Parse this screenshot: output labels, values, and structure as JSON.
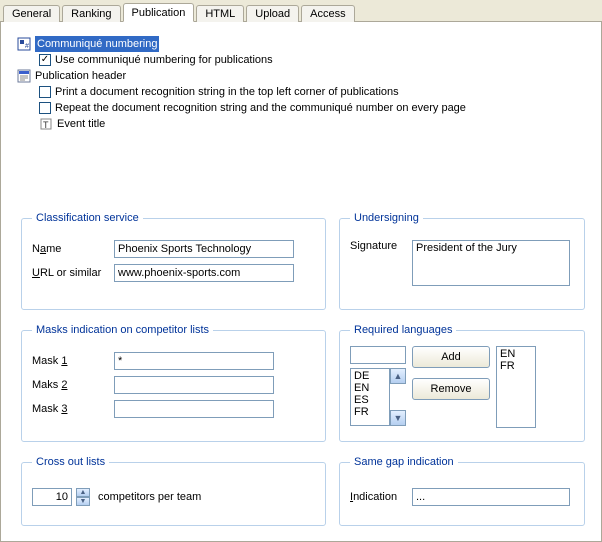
{
  "tabs": {
    "general": "General",
    "ranking": "Ranking",
    "publication": "Publication",
    "html": "HTML",
    "upload": "Upload",
    "access": "Access"
  },
  "tree": {
    "communique_numbering": "Communiqué numbering",
    "use_communique": "Use communiqué numbering for publications",
    "use_communique_checked": "✓",
    "publication_header": "Publication header",
    "print_recognition": "Print a document recognition string in the top left corner of publications",
    "repeat_recognition": "Repeat the document recognition string and the communiqué number on every page",
    "event_title": "Event title"
  },
  "classification": {
    "legend": "Classification service",
    "name_label_pre": "N",
    "name_label_u": "a",
    "name_label_post": "me",
    "name_value": "Phoenix Sports Technology",
    "url_label_u": "U",
    "url_label_post": "RL or similar",
    "url_value": "www.phoenix-sports.com"
  },
  "undersigning": {
    "legend": "Undersigning",
    "sig_label_pre": "Si",
    "sig_label_u": "g",
    "sig_label_post": "nature",
    "sig_value": "President of the Jury"
  },
  "masks": {
    "legend": "Masks indication on competitor lists",
    "m1_label_pre": "Mask ",
    "m1_label_u": "1",
    "m1_value": "*",
    "m2_label_pre": "Maks ",
    "m2_label_u": "2",
    "m2_value": "",
    "m3_label_pre": "Mask ",
    "m3_label_u": "3",
    "m3_value": ""
  },
  "languages": {
    "legend": "Required languages",
    "input_value": "",
    "add_label": "Add",
    "remove_label": "Remove",
    "available": {
      "0": "DE",
      "1": "EN",
      "2": "ES",
      "3": "FR"
    },
    "selected": {
      "0": "EN",
      "1": "FR"
    }
  },
  "crossout": {
    "legend": "Cross out lists",
    "value": "10",
    "suffix": "competitors per team"
  },
  "samegap": {
    "legend": "Same gap indication",
    "label_u": "I",
    "label_post": "ndication",
    "value": "..."
  }
}
